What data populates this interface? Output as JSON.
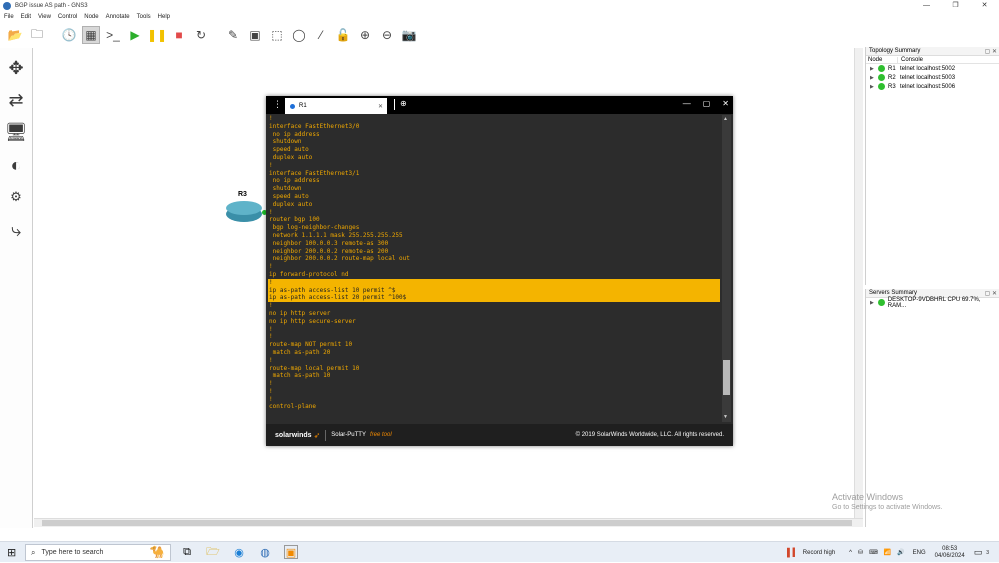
{
  "window": {
    "title": "BGP issue AS path - GNS3",
    "controls": {
      "minimize": "—",
      "maximize": "❐",
      "close": "✕"
    }
  },
  "menu": [
    "File",
    "Edit",
    "View",
    "Control",
    "Node",
    "Annotate",
    "Tools",
    "Help"
  ],
  "toolbar_icons": [
    "open-folder-icon",
    "folder-icon",
    "clock-icon",
    "snapshot-icon",
    "console-icon",
    "play-icon",
    "pause-icon",
    "stop-icon",
    "reload-icon",
    "edit-note-icon",
    "image-icon",
    "rectangle-icon",
    "ellipse-icon",
    "line-icon",
    "lock-icon",
    "zoom-in-icon",
    "zoom-out-icon",
    "screenshot-icon"
  ],
  "sidebar_icons": [
    "router-group-icon",
    "switch-group-icon",
    "end-device-icon",
    "security-device-icon",
    "all-devices-icon",
    "link-icon"
  ],
  "canvas": {
    "router_label": "R3"
  },
  "topology_summary": {
    "title": "Topology Summary",
    "col_node": "Node",
    "col_console": "Console",
    "rows": [
      {
        "node": "R1",
        "console": "telnet localhost:5002"
      },
      {
        "node": "R2",
        "console": "telnet localhost:5003"
      },
      {
        "node": "R3",
        "console": "telnet localhost:5006"
      }
    ]
  },
  "servers_summary": {
    "title": "Servers Summary",
    "rows": [
      {
        "server": "DESKTOP-9VDBHRL CPU 69.7%, RAM..."
      }
    ]
  },
  "putty": {
    "tab_label": "R1",
    "terminal_lines": [
      "!",
      "interface FastEthernet3/0",
      " no ip address",
      " shutdown",
      " speed auto",
      " duplex auto",
      "!",
      "interface FastEthernet3/1",
      " no ip address",
      " shutdown",
      " speed auto",
      " duplex auto",
      "!",
      "router bgp 100",
      " bgp log-neighbor-changes",
      " network 1.1.1.1 mask 255.255.255.255",
      " neighbor 100.0.0.3 remote-as 300",
      " neighbor 200.0.0.2 remote-as 200",
      " neighbor 200.0.0.2 route-map local out",
      "!",
      "ip forward-protocol nd",
      "!",
      "ip as-path access-list 10 permit ^$",
      "ip as-path access-list 20 permit ^100$",
      "!",
      "no ip http server",
      "no ip http secure-server",
      "!",
      "!",
      "route-map NOT permit 10",
      " match as-path 20",
      "!",
      "route-map local permit 10",
      " match as-path 10",
      "!",
      "!",
      "!",
      "control-plane"
    ],
    "highlighted_lines": [
      21,
      22,
      23
    ],
    "footer": {
      "brand": "solarwinds",
      "product": "Solar-PuTTY",
      "free_label": "free tool",
      "copyright": "© 2019 SolarWinds Worldwide, LLC. All rights reserved."
    }
  },
  "watermark": {
    "line1": "Activate Windows",
    "line2": "Go to Settings to activate Windows."
  },
  "taskbar": {
    "search_placeholder": "Type here to search",
    "record_label": "Record high",
    "language": "ENG",
    "time": "08:53",
    "date": "04/06/2024",
    "notification_count": "3"
  },
  "colors": {
    "terminal_text": "#f0a800",
    "highlight": "#f4b400",
    "terminal_bg": "#2c2c2c",
    "status_green": "#2fbf2f"
  }
}
